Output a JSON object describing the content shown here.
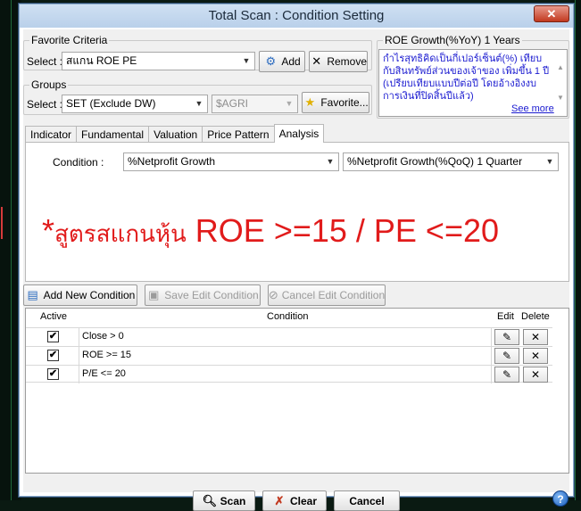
{
  "window": {
    "title": "Total Scan : Condition Setting",
    "close_label": "✕"
  },
  "favorite": {
    "legend": "Favorite Criteria",
    "select_label": "Select :",
    "selected": "สแกน ROE PE",
    "add_label": "Add",
    "remove_label": "Remove"
  },
  "groups": {
    "legend": "Groups",
    "select_label": "Select :",
    "selected": "SET (Exclude DW)",
    "sector_selected": "$AGRI",
    "favorite_label": "Favorite..."
  },
  "description": {
    "legend": "ROE Growth(%YoY) 1 Years",
    "text": "กำไรสุทธิคิดเป็นกี่เปอร์เซ็นต์(%) เทียบกับสินทรัพย์ส่วนของเจ้าของ เพิ่มขึ้น 1 ปี (เปรียบเทียบแบบปีต่อปี โดยอ้างอิงงบการเงินที่ปิดสิ้นปีแล้ว)",
    "see_more": "See more"
  },
  "tabs": [
    {
      "label": "Indicator"
    },
    {
      "label": "Fundamental"
    },
    {
      "label": "Valuation"
    },
    {
      "label": "Price Pattern"
    },
    {
      "label": "Analysis"
    }
  ],
  "active_tab": "Analysis",
  "condition": {
    "label": "Condition :",
    "selected": "%Netprofit Growth",
    "sub_selected": "%Netprofit Growth(%QoQ) 1 Quarter"
  },
  "banner": {
    "asterisk": "*",
    "thai": "สูตรสแกนหุ้น",
    "text": " ROE >=15 / PE <=20"
  },
  "actions": {
    "add_new": "Add New Condition",
    "save_edit": "Save Edit Condition",
    "cancel_edit": "Cancel Edit Condition"
  },
  "grid": {
    "headers": {
      "active": "Active",
      "condition": "Condition",
      "edit": "Edit",
      "delete": "Delete"
    },
    "rows": [
      {
        "active": true,
        "condition": "Close > 0"
      },
      {
        "active": true,
        "condition": "ROE >= 15"
      },
      {
        "active": true,
        "condition": "P/E <= 20"
      }
    ]
  },
  "footer": {
    "scan": "Scan",
    "clear": "Clear",
    "cancel": "Cancel",
    "help": "?"
  },
  "colors": {
    "banner": "#e11b1b",
    "description_text": "#1a1ad0",
    "close_button": "#c2391f"
  },
  "icons": [
    "gear-add-icon",
    "x-icon",
    "star-icon",
    "list-add-icon",
    "save-icon",
    "cancel-circle-icon",
    "pencil-icon",
    "search-icon",
    "clear-icon",
    "help-icon"
  ]
}
